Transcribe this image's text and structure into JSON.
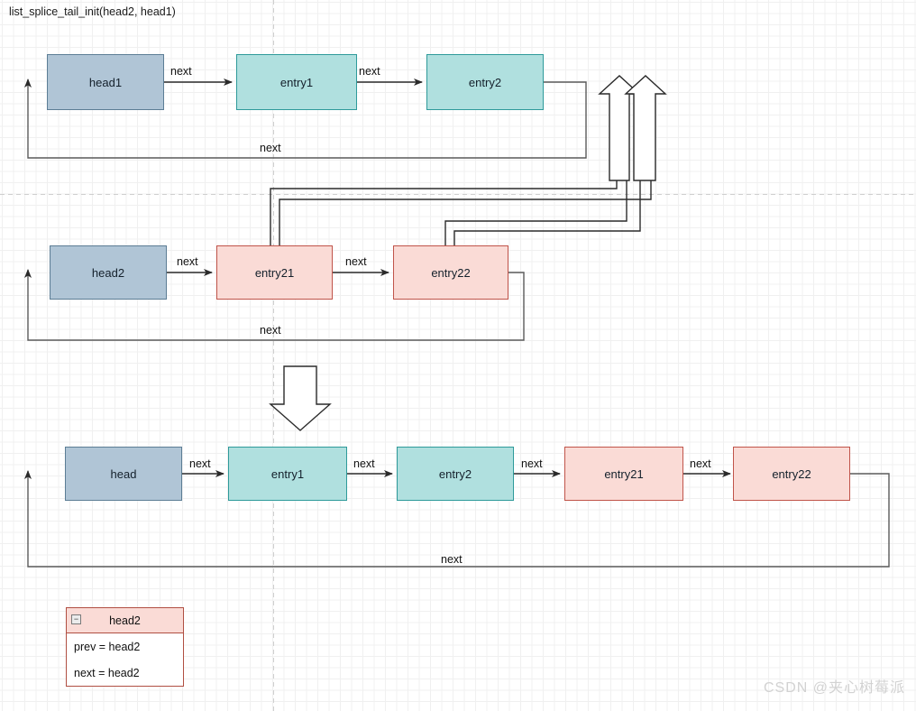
{
  "title": "list_splice_tail_init(head2, head1)",
  "watermark": "CSDN @夹心树莓派",
  "edge_label": "next",
  "rows": {
    "row1": {
      "nodes": [
        {
          "label": "head1",
          "kind": "head"
        },
        {
          "label": "entry1",
          "kind": "cyan"
        },
        {
          "label": "entry2",
          "kind": "cyan"
        }
      ],
      "loop_label": "next",
      "link_labels": [
        "next",
        "next"
      ]
    },
    "row2": {
      "nodes": [
        {
          "label": "head2",
          "kind": "head"
        },
        {
          "label": "entry21",
          "kind": "pink"
        },
        {
          "label": "entry22",
          "kind": "pink"
        }
      ],
      "loop_label": "next",
      "link_labels": [
        "next",
        "next"
      ]
    },
    "row3": {
      "nodes": [
        {
          "label": "head",
          "kind": "head"
        },
        {
          "label": "entry1",
          "kind": "cyan"
        },
        {
          "label": "entry2",
          "kind": "cyan"
        },
        {
          "label": "entry21",
          "kind": "pink"
        },
        {
          "label": "entry22",
          "kind": "pink"
        }
      ],
      "loop_label": "next",
      "link_labels": [
        "next",
        "next",
        "next",
        "next"
      ]
    }
  },
  "uml_box": {
    "title": "head2",
    "collapse_glyph": "−",
    "fields": [
      "prev = head2",
      "next = head2"
    ]
  },
  "colors": {
    "head_fill": "#b0c5d6",
    "head_stroke": "#5c7d95",
    "cyan_fill": "#b0e0df",
    "cyan_stroke": "#2e9a9a",
    "pink_fill": "#fadbd6",
    "pink_stroke": "#c0544a",
    "wire": "#3a3a3a",
    "loop_wire": "#5a5a5a",
    "grid_minor": "#f0f0f0",
    "grid_major": "#e2e2e2",
    "guide": "#cfcfcf"
  },
  "icons": {
    "big_up_arrow_1": "block-arrow-up-icon",
    "big_up_arrow_2": "block-arrow-up-icon",
    "big_down_arrow": "block-arrow-down-icon"
  }
}
